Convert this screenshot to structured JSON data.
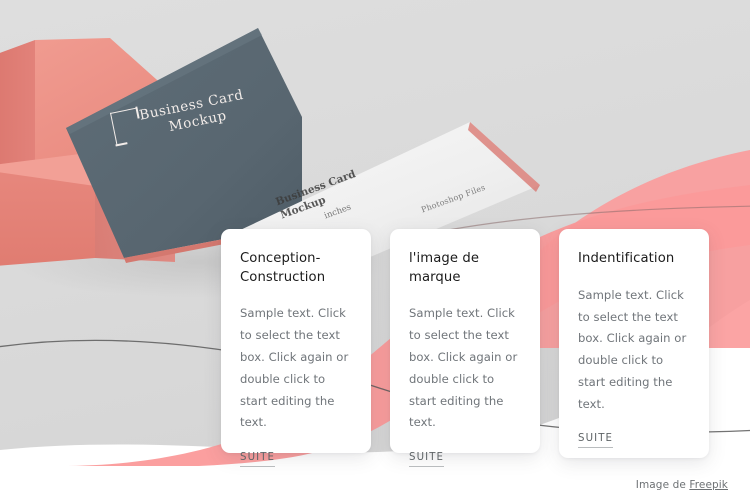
{
  "hero": {
    "name": "business-card-mockup-hero",
    "colors": {
      "background_grey": "#dcdcdc",
      "page_white": "#ffffff",
      "accent_pink": "#fb9a9a",
      "box_pink": "#ec8177",
      "card_dark": "#5a6972",
      "curve_line": "#5b5b5b"
    },
    "mockup": {
      "front_card_line1": "Business Card",
      "front_card_line2": "Mockup",
      "logo_icon": "square-bracket-logo-icon",
      "back_card_line1": "Business Card",
      "back_card_line2": "Mockup",
      "back_card_sub": "inches",
      "back_card_side": "Photoshop Files"
    }
  },
  "cards": [
    {
      "id": "conception-construction",
      "title": "Conception-Construction",
      "body": "Sample text. Click to select the text box. Click again or double click to start editing the text.",
      "link_label": "SUITE"
    },
    {
      "id": "l-image-de-marque",
      "title": "l'image de marque",
      "body": "Sample text. Click to select the text box. Click again or double click to start editing the text.",
      "link_label": "SUITE"
    },
    {
      "id": "indentification",
      "title": "Indentification",
      "body": "Sample text. Click to select the text box. Click again or double click to start editing the text.",
      "link_label": "SUITE"
    }
  ],
  "attribution": {
    "prefix": "Image de ",
    "link_label": "Freepik"
  }
}
